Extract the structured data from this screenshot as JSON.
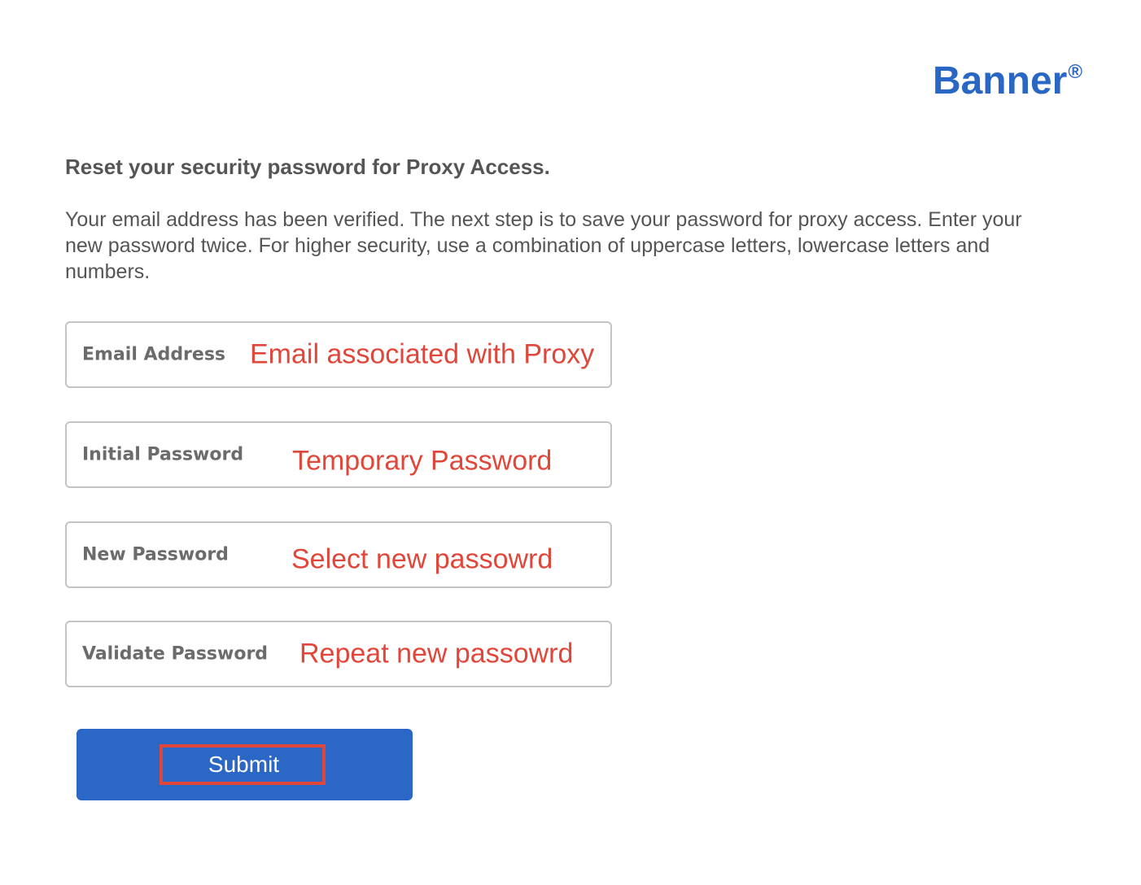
{
  "logo": {
    "text": "Banner",
    "mark": "®",
    "color": "#2a66c4"
  },
  "heading": "Reset your security password for Proxy Access.",
  "description": "Your email address has been verified. The next step is to save your password for proxy access. Enter your new password twice. For higher security, use a combination of uppercase letters, lowercase letters and numbers.",
  "fields": [
    {
      "label": "Email Address",
      "value": "Email associated with Proxy"
    },
    {
      "label": "Initial Password",
      "value": "Temporary Password"
    },
    {
      "label": "New Password",
      "value": "Select new passowrd"
    },
    {
      "label": "Validate Password",
      "value": "Repeat new passowrd"
    }
  ],
  "submit": {
    "label": "Submit",
    "color": "#2b67c5"
  },
  "colors": {
    "annotation": "#e0473a",
    "text": "#555555"
  }
}
